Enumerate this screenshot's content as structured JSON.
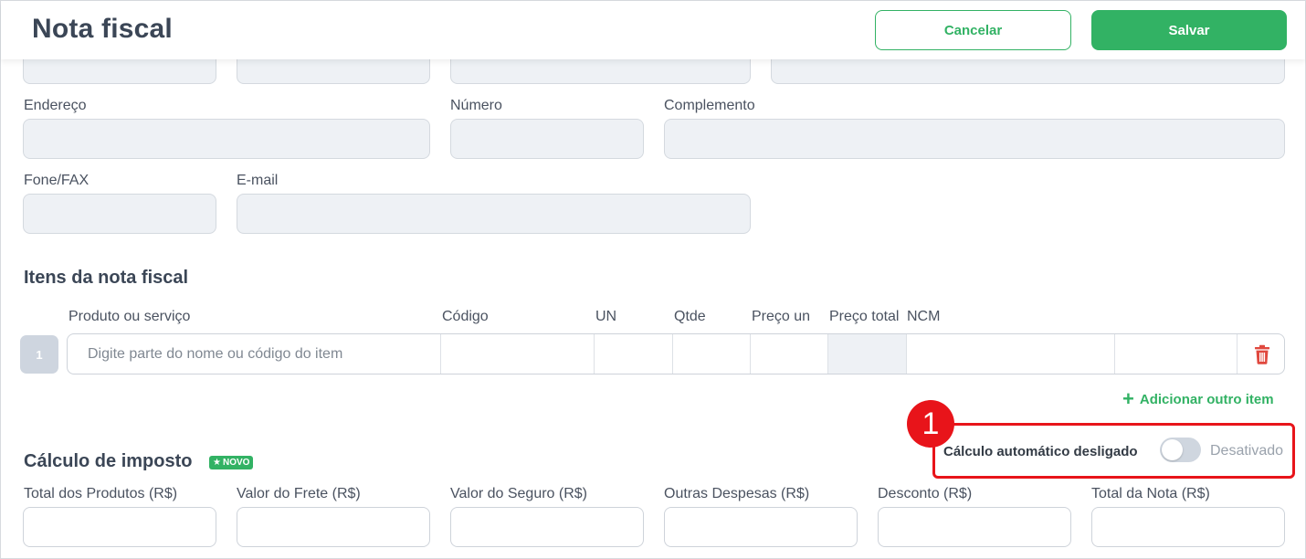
{
  "header": {
    "title": "Nota fiscal",
    "cancel_label": "Cancelar",
    "save_label": "Salvar"
  },
  "address": {
    "endereco_label": "Endereço",
    "numero_label": "Número",
    "complemento_label": "Complemento",
    "fone_label": "Fone/FAX",
    "email_label": "E-mail"
  },
  "items": {
    "section_title": "Itens da nota fiscal",
    "columns": {
      "produto": "Produto ou serviço",
      "codigo": "Código",
      "un": "UN",
      "qtde": "Qtde",
      "preco_un": "Preço un",
      "preco_total": "Preço total",
      "ncm": "NCM"
    },
    "row_number": "1",
    "product_placeholder": "Digite parte do nome ou código do item",
    "add_item_label": "Adicionar outro item"
  },
  "tax": {
    "section_title": "Cálculo de imposto",
    "badge": "NOVO",
    "callout_number": "1",
    "auto_calc_label": "Cálculo automático desligado",
    "toggle_state": "Desativado",
    "toggle_on": false,
    "fields": {
      "total_produtos": "Total dos Produtos (R$)",
      "valor_frete": "Valor do Frete (R$)",
      "valor_seguro": "Valor do Seguro (R$)",
      "outras_despesas": "Outras Despesas (R$)",
      "desconto": "Desconto (R$)",
      "total_nota": "Total da Nota (R$)"
    }
  },
  "colors": {
    "accent": "#32b264",
    "highlight": "#e8141a",
    "delete": "#e0483e"
  }
}
